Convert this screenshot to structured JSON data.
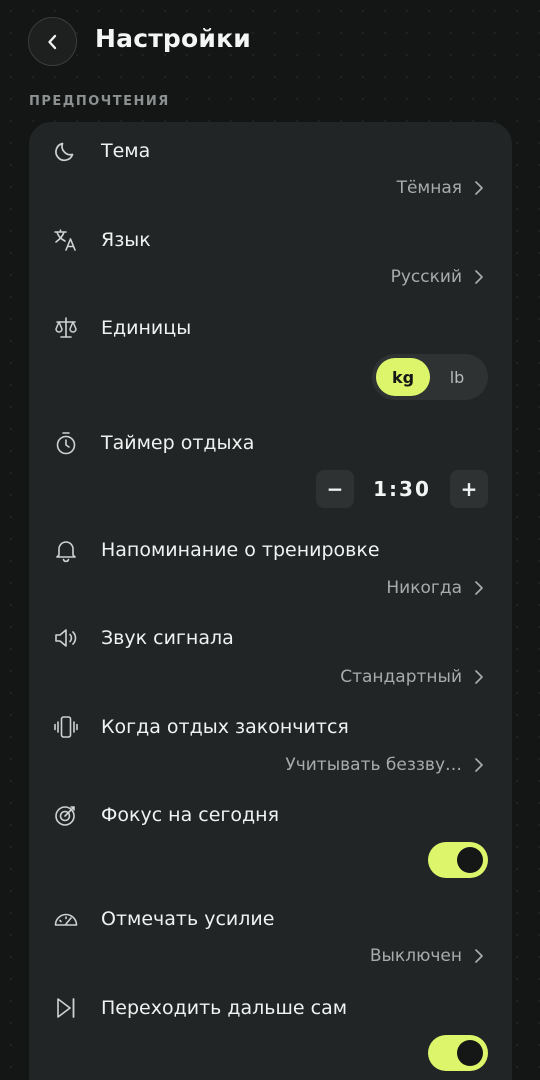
{
  "header": {
    "title": "Настройки",
    "back_icon": "chevron-left-icon"
  },
  "section": {
    "title": "ПРЕДПОЧТЕНИЯ"
  },
  "settings": {
    "theme": {
      "label": "Тема",
      "value": "Тёмная",
      "icon": "moon-icon"
    },
    "language": {
      "label": "Язык",
      "value": "Русский",
      "icon": "translate-icon"
    },
    "units": {
      "label": "Единицы",
      "icon": "scale-icon",
      "options": [
        "kg",
        "lb"
      ],
      "selected": "kg"
    },
    "rest_timer": {
      "label": "Таймер отдыха",
      "icon": "stopwatch-icon",
      "value": "1:30",
      "decrement": "−",
      "increment": "+"
    },
    "reminder": {
      "label": "Напоминание о тренировке",
      "value": "Никогда",
      "icon": "bell-icon"
    },
    "signal_sound": {
      "label": "Звук сигнала",
      "value": "Стандартный",
      "icon": "speaker-icon"
    },
    "rest_end": {
      "label": "Когда отдых закончится",
      "value": "Учитывать беззву…",
      "icon": "vibrate-icon"
    },
    "focus_today": {
      "label": "Фокус на сегодня",
      "icon": "target-icon",
      "on": true
    },
    "mark_effort": {
      "label": "Отмечать усилие",
      "value": "Выключен",
      "icon": "gauge-icon"
    },
    "auto_advance": {
      "label": "Переходить дальше сам",
      "icon": "skip-next-icon",
      "on": true
    }
  },
  "colors": {
    "accent": "#ddf56b",
    "background": "#141515",
    "card": "#222525"
  }
}
